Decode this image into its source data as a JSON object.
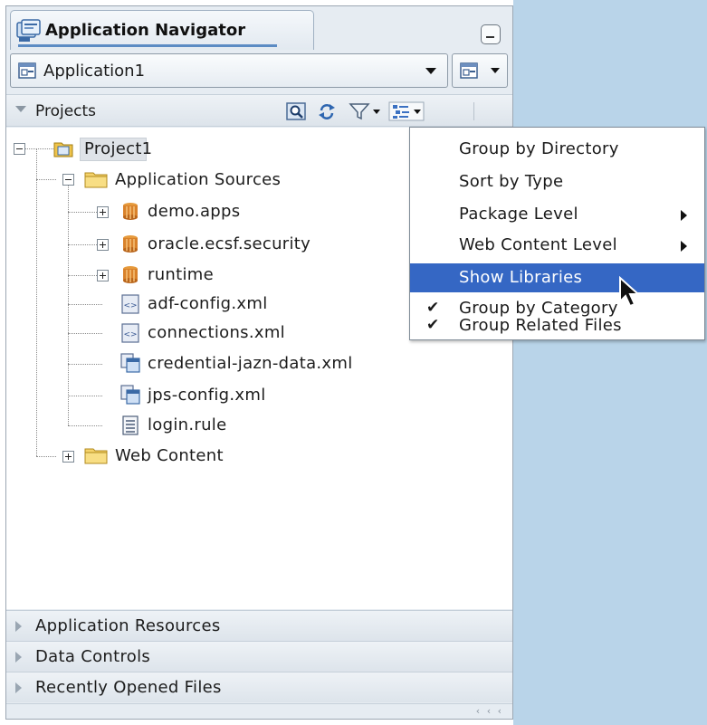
{
  "navigator": {
    "title": "Application Navigator",
    "application_selector": {
      "value": "Application1"
    }
  },
  "projects": {
    "header": "Projects",
    "toolbar": {
      "icons": [
        "search-icon",
        "refresh-icon",
        "filter-icon",
        "tree-options-icon"
      ]
    }
  },
  "tree": {
    "project": "Project1",
    "application_sources": "Application Sources",
    "items": [
      {
        "label": "demo.apps",
        "icon": "package-icon",
        "expandable": true
      },
      {
        "label": "oracle.ecsf.security",
        "icon": "package-icon",
        "expandable": true
      },
      {
        "label": "runtime",
        "icon": "package-icon",
        "expandable": true
      },
      {
        "label": "adf-config.xml",
        "icon": "xml-file-icon",
        "expandable": false
      },
      {
        "label": "connections.xml",
        "icon": "xml-file-icon",
        "expandable": false
      },
      {
        "label": "credential-jazn-data.xml",
        "icon": "config-file-icon",
        "expandable": false
      },
      {
        "label": "jps-config.xml",
        "icon": "config-file-icon",
        "expandable": false
      },
      {
        "label": "login.rule",
        "icon": "text-file-icon",
        "expandable": false
      }
    ],
    "web_content": "Web Content"
  },
  "accordion": [
    {
      "label": "Application Resources"
    },
    {
      "label": "Data Controls"
    },
    {
      "label": "Recently Opened Files"
    }
  ],
  "statusbar": {
    "grip": "‹ ‹ ‹"
  },
  "menu": {
    "items": [
      {
        "label": "Group by Directory",
        "checked": false,
        "submenu": false,
        "highlighted": false
      },
      {
        "label": "Sort by Type",
        "checked": false,
        "submenu": false,
        "highlighted": false
      },
      {
        "label": "Package Level",
        "checked": false,
        "submenu": true,
        "highlighted": false
      },
      {
        "label": "Web Content Level",
        "checked": false,
        "submenu": true,
        "highlighted": false
      },
      {
        "label": "Show Libraries",
        "checked": false,
        "submenu": false,
        "highlighted": true
      },
      {
        "label": "Group by Category",
        "checked": true,
        "submenu": false,
        "highlighted": false
      },
      {
        "label": "Group Related Files",
        "checked": true,
        "submenu": false,
        "highlighted": false
      }
    ]
  },
  "colors": {
    "menu_highlight": "#3567c4",
    "desktop_background": "#b9d4e9",
    "panel_background": "#e6ecf2"
  }
}
